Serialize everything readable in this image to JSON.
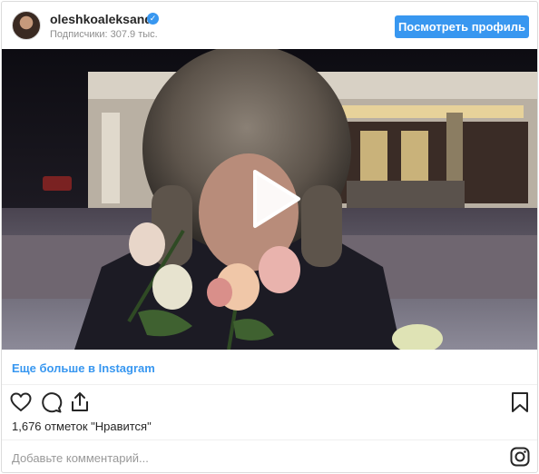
{
  "header": {
    "username": "oleshkoaleksandr",
    "verified_mark": "✓",
    "followers": "Подписчики: 307.9 тыс.",
    "view_profile_label": "Посмотреть профиль"
  },
  "media": {
    "play_icon": "play-icon"
  },
  "more_link": "Еще больше в Instagram",
  "actions": {
    "icons": [
      "heart-icon",
      "comment-icon",
      "share-icon",
      "bookmark-icon"
    ]
  },
  "likes_text": "1,676 отметок \"Нравится\"",
  "comment": {
    "placeholder": "Добавьте комментарий..."
  },
  "colors": {
    "accent": "#3897f0",
    "text": "#262626",
    "muted": "#8e8e8e"
  }
}
